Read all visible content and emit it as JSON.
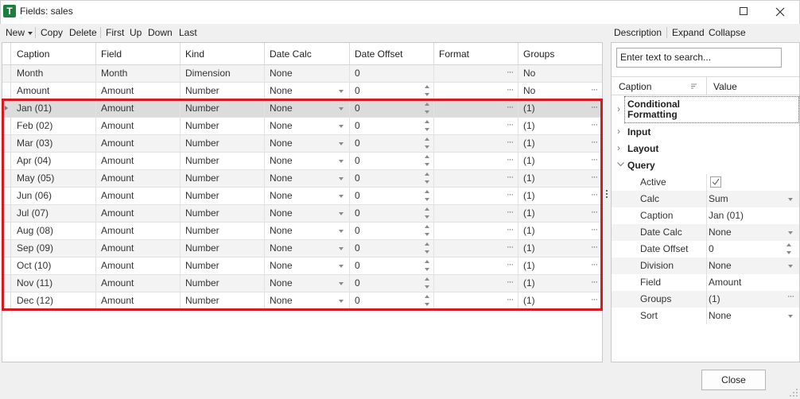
{
  "window": {
    "title": "Fields: sales",
    "app_icon_letter": "T",
    "accent_color": "#1e7d3c"
  },
  "toolbar": {
    "new_label": "New",
    "copy_label": "Copy",
    "delete_label": "Delete",
    "first_label": "First",
    "up_label": "Up",
    "down_label": "Down",
    "last_label": "Last"
  },
  "grid": {
    "columns": [
      "Caption",
      "Field",
      "Kind",
      "Date Calc",
      "Date Offset",
      "Format",
      "Groups"
    ],
    "rows": [
      {
        "caption": "Month",
        "field": "Month",
        "kind": "Dimension",
        "date_calc": "None",
        "date_offset": "0",
        "format": "",
        "groups": "No"
      },
      {
        "caption": "Amount",
        "field": "Amount",
        "kind": "Number",
        "date_calc": "None",
        "date_offset": "0",
        "format": "",
        "groups": "No"
      },
      {
        "caption": "Jan (01)",
        "field": "Amount",
        "kind": "Number",
        "date_calc": "None",
        "date_offset": "0",
        "format": "",
        "groups": "(1)"
      },
      {
        "caption": "Feb (02)",
        "field": "Amount",
        "kind": "Number",
        "date_calc": "None",
        "date_offset": "0",
        "format": "",
        "groups": "(1)"
      },
      {
        "caption": "Mar (03)",
        "field": "Amount",
        "kind": "Number",
        "date_calc": "None",
        "date_offset": "0",
        "format": "",
        "groups": "(1)"
      },
      {
        "caption": "Apr (04)",
        "field": "Amount",
        "kind": "Number",
        "date_calc": "None",
        "date_offset": "0",
        "format": "",
        "groups": "(1)"
      },
      {
        "caption": "May (05)",
        "field": "Amount",
        "kind": "Number",
        "date_calc": "None",
        "date_offset": "0",
        "format": "",
        "groups": "(1)"
      },
      {
        "caption": "Jun (06)",
        "field": "Amount",
        "kind": "Number",
        "date_calc": "None",
        "date_offset": "0",
        "format": "",
        "groups": "(1)"
      },
      {
        "caption": "Jul (07)",
        "field": "Amount",
        "kind": "Number",
        "date_calc": "None",
        "date_offset": "0",
        "format": "",
        "groups": "(1)"
      },
      {
        "caption": "Aug (08)",
        "field": "Amount",
        "kind": "Number",
        "date_calc": "None",
        "date_offset": "0",
        "format": "",
        "groups": "(1)"
      },
      {
        "caption": "Sep (09)",
        "field": "Amount",
        "kind": "Number",
        "date_calc": "None",
        "date_offset": "0",
        "format": "",
        "groups": "(1)"
      },
      {
        "caption": "Oct (10)",
        "field": "Amount",
        "kind": "Number",
        "date_calc": "None",
        "date_offset": "0",
        "format": "",
        "groups": "(1)"
      },
      {
        "caption": "Nov (11)",
        "field": "Amount",
        "kind": "Number",
        "date_calc": "None",
        "date_offset": "0",
        "format": "",
        "groups": "(1)"
      },
      {
        "caption": "Dec (12)",
        "field": "Amount",
        "kind": "Number",
        "date_calc": "None",
        "date_offset": "0",
        "format": "",
        "groups": "(1)"
      }
    ],
    "highlight_color": "#d71920"
  },
  "right_toolbar": {
    "description_label": "Description",
    "expand_label": "Expand",
    "collapse_label": "Collapse"
  },
  "properties": {
    "search_placeholder": "Enter text to search...",
    "header_caption": "Caption",
    "header_value": "Value",
    "categories": {
      "conditional_formatting": "Conditional Formatting",
      "input": "Input",
      "layout": "Layout",
      "query": "Query"
    },
    "query_items": [
      {
        "name": "Active",
        "value": ""
      },
      {
        "name": "Calc",
        "value": "Sum"
      },
      {
        "name": "Caption",
        "value": "Jan (01)"
      },
      {
        "name": "Date Calc",
        "value": "None"
      },
      {
        "name": "Date Offset",
        "value": "0"
      },
      {
        "name": "Division",
        "value": "None"
      },
      {
        "name": "Field",
        "value": "Amount"
      },
      {
        "name": "Groups",
        "value": "(1)"
      },
      {
        "name": "Sort",
        "value": "None"
      }
    ]
  },
  "footer": {
    "close_label": "Close"
  }
}
